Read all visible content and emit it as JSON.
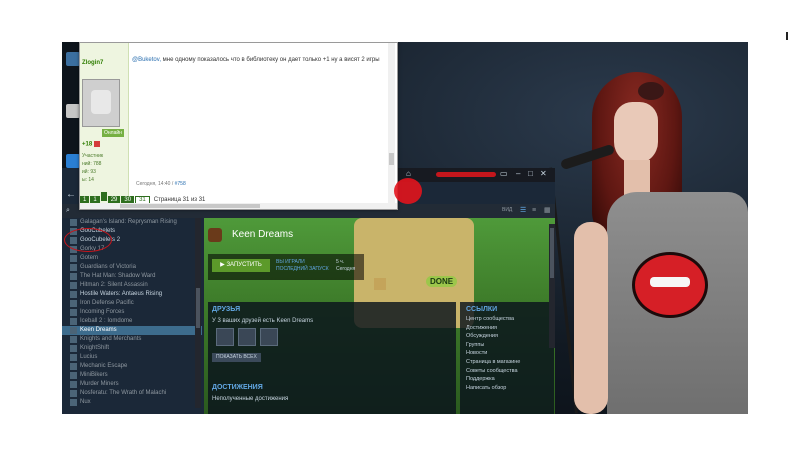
{
  "forum": {
    "username": "Zlogin7",
    "online_badge": "Онлайн",
    "reputation": "+18",
    "rank": "Участник",
    "stats": [
      "ний: 788",
      "ий: 93",
      "ы: 14"
    ],
    "message_user": "@Buketov,",
    "message_text": " мне одному показалось что в библиотеку он дает только +1 ну а висят 2 игры",
    "date_text": "Сегодня, 14:40 / ",
    "post_link": "#758",
    "pages": [
      "1",
      "1",
      "",
      "29",
      "30",
      "31"
    ],
    "page_label": "Страница 31 из 31"
  },
  "steam": {
    "view_label": "ВИД",
    "library": [
      {
        "name": "Galagan's Island: Reprysman Rising",
        "installed": false
      },
      {
        "name": "GooCubelets",
        "installed": true
      },
      {
        "name": "GooCubelets 2",
        "installed": true
      },
      {
        "name": "Gorky 17",
        "installed": false
      },
      {
        "name": "Gotem",
        "installed": false
      },
      {
        "name": "Guardians of Victoria",
        "installed": false
      },
      {
        "name": "The Hat Man: Shadow Ward",
        "installed": false
      },
      {
        "name": "Hitman 2: Silent Assassin",
        "installed": false
      },
      {
        "name": "Hostile Waters: Antaeus Rising",
        "installed": true
      },
      {
        "name": "Iron Defense Pacific",
        "installed": false
      },
      {
        "name": "Incoming Forces",
        "installed": false
      },
      {
        "name": "Iceball 2 : Iomdome",
        "installed": false
      },
      {
        "name": "Keen Dreams",
        "installed": true,
        "selected": true
      },
      {
        "name": "Knights and Merchants",
        "installed": false
      },
      {
        "name": "KnightShift",
        "installed": false
      },
      {
        "name": "Lucius",
        "installed": false
      },
      {
        "name": "Mechanic Escape",
        "installed": false
      },
      {
        "name": "MiniBikers",
        "installed": false
      },
      {
        "name": "Murder Miners",
        "installed": false
      },
      {
        "name": "Nosferatu: The Wrath of Malachi",
        "installed": false
      },
      {
        "name": "Nux",
        "installed": false
      }
    ],
    "game_title": "Keen Dreams",
    "launch_label": "ЗАПУСТИТЬ",
    "played_label": "ВЫ ИГРАЛИ",
    "played_value": "5 ч.",
    "last_launch_label": "ПОСЛЕДНИЙ ЗАПУСК",
    "last_launch_value": "Сегодня",
    "friends_title": "ДРУЗЬЯ",
    "friends_text": "У 3 ваших друзей есть Keen Dreams",
    "show_all": "ПОКАЗАТЬ ВСЕХ",
    "achievements_title": "ДОСТИЖЕНИЯ",
    "achievements_text": "Неполученные достижения",
    "links_title": "ССЫЛКИ",
    "links": [
      "Центр сообщества",
      "Достижения",
      "Обсуждения",
      "Группы",
      "Новости",
      "Страница в магазине",
      "Советы сообщества",
      "Поддержка",
      "Написать обзор"
    ],
    "done_sign": "DONE"
  },
  "colors": {
    "steam_bg": "#1b2838",
    "steam_accent": "#62a7e3",
    "launch_green": "#5c9a2a",
    "forum_green": "#2e6e1e",
    "annotation_red": "#c4161c"
  }
}
